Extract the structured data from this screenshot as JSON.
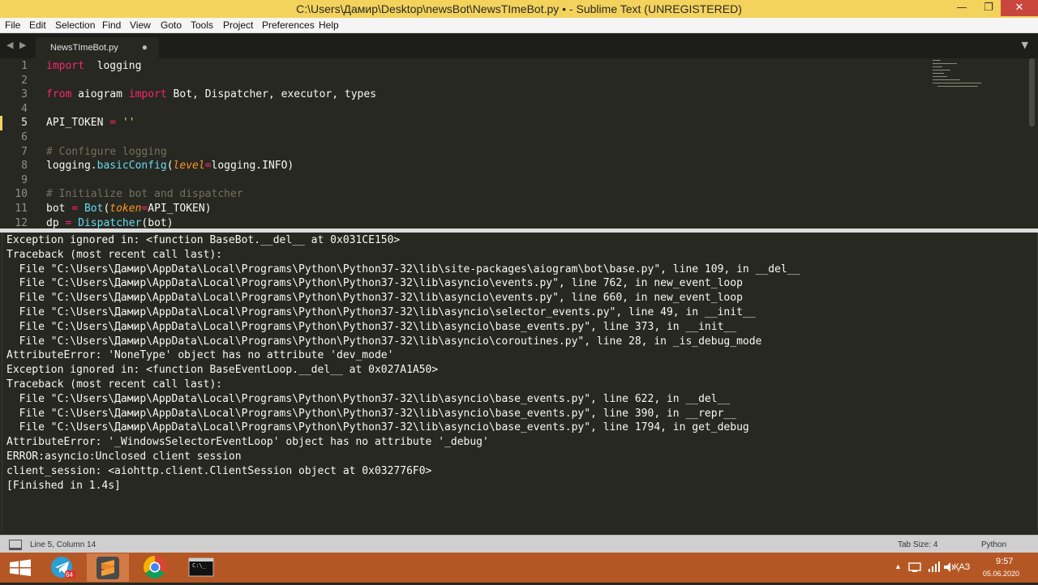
{
  "window": {
    "title": "C:\\Users\\Дамир\\Desktop\\newsBot\\NewsTImeBot.py • - Sublime Text (UNREGISTERED)",
    "minimize_glyph": "—",
    "maximize_glyph": "❐",
    "close_glyph": "✕"
  },
  "menu": [
    "File",
    "Edit",
    "Selection",
    "Find",
    "View",
    "Goto",
    "Tools",
    "Project",
    "Preferences",
    "Help"
  ],
  "tabbar": {
    "nav_glyph": "◀ ▶",
    "dropdown_glyph": "▼",
    "tab": {
      "label": "NewsTImeBot.py",
      "modified_glyph": "●"
    }
  },
  "editor": {
    "line_numbers": [
      "1",
      "2",
      "3",
      "4",
      "5",
      "6",
      "7",
      "8",
      "9",
      "10",
      "11",
      "12"
    ],
    "lines": [
      {
        "parts": [
          [
            "kw",
            "import"
          ],
          [
            "",
            "  logging"
          ]
        ]
      },
      {
        "parts": []
      },
      {
        "parts": [
          [
            "kw",
            "from"
          ],
          [
            "",
            " aiogram "
          ],
          [
            "kw",
            "import"
          ],
          [
            "",
            " Bot, Dispatcher, executor, types"
          ]
        ]
      },
      {
        "parts": []
      },
      {
        "parts": [
          [
            "",
            "API_TOKEN "
          ],
          [
            "kw",
            "="
          ],
          [
            "",
            " "
          ],
          [
            "st",
            "''"
          ]
        ]
      },
      {
        "parts": []
      },
      {
        "parts": [
          [
            "cm",
            "# Configure logging"
          ]
        ]
      },
      {
        "parts": [
          [
            "",
            "logging."
          ],
          [
            "fn",
            "basicConfig"
          ],
          [
            "",
            "("
          ],
          [
            "pa",
            "level"
          ],
          [
            "kw",
            "="
          ],
          [
            "",
            "logging.INFO)"
          ]
        ]
      },
      {
        "parts": []
      },
      {
        "parts": [
          [
            "cm",
            "# Initialize bot and dispatcher"
          ]
        ]
      },
      {
        "parts": [
          [
            "",
            "bot "
          ],
          [
            "kw",
            "="
          ],
          [
            "",
            " "
          ],
          [
            "fn",
            "Bot"
          ],
          [
            "",
            "("
          ],
          [
            "pa",
            "token"
          ],
          [
            "kw",
            "="
          ],
          [
            "",
            "API_TOKEN)"
          ]
        ]
      },
      {
        "parts": [
          [
            "",
            "dp "
          ],
          [
            "kw",
            "="
          ],
          [
            "",
            " "
          ],
          [
            "fn",
            "Dispatcher"
          ],
          [
            "",
            "(bot)"
          ]
        ]
      }
    ]
  },
  "output": [
    "Exception ignored in: <function BaseBot.__del__ at 0x031CE150>",
    "Traceback (most recent call last):",
    "  File \"C:\\Users\\Дамир\\AppData\\Local\\Programs\\Python\\Python37-32\\lib\\site-packages\\aiogram\\bot\\base.py\", line 109, in __del__",
    "  File \"C:\\Users\\Дамир\\AppData\\Local\\Programs\\Python\\Python37-32\\lib\\asyncio\\events.py\", line 762, in new_event_loop",
    "  File \"C:\\Users\\Дамир\\AppData\\Local\\Programs\\Python\\Python37-32\\lib\\asyncio\\events.py\", line 660, in new_event_loop",
    "  File \"C:\\Users\\Дамир\\AppData\\Local\\Programs\\Python\\Python37-32\\lib\\asyncio\\selector_events.py\", line 49, in __init__",
    "  File \"C:\\Users\\Дамир\\AppData\\Local\\Programs\\Python\\Python37-32\\lib\\asyncio\\base_events.py\", line 373, in __init__",
    "  File \"C:\\Users\\Дамир\\AppData\\Local\\Programs\\Python\\Python37-32\\lib\\asyncio\\coroutines.py\", line 28, in _is_debug_mode",
    "AttributeError: 'NoneType' object has no attribute 'dev_mode'",
    "Exception ignored in: <function BaseEventLoop.__del__ at 0x027A1A50>",
    "Traceback (most recent call last):",
    "  File \"C:\\Users\\Дамир\\AppData\\Local\\Programs\\Python\\Python37-32\\lib\\asyncio\\base_events.py\", line 622, in __del__",
    "  File \"C:\\Users\\Дамир\\AppData\\Local\\Programs\\Python\\Python37-32\\lib\\asyncio\\base_events.py\", line 390, in __repr__",
    "  File \"C:\\Users\\Дамир\\AppData\\Local\\Programs\\Python\\Python37-32\\lib\\asyncio\\base_events.py\", line 1794, in get_debug",
    "AttributeError: '_WindowsSelectorEventLoop' object has no attribute '_debug'",
    "ERROR:asyncio:Unclosed client session",
    "client_session: <aiohttp.client.ClientSession object at 0x032776F0>",
    "[Finished in 1.4s]"
  ],
  "statusbar": {
    "position": "Line 5, Column 14",
    "tab_size": "Tab Size: 4",
    "syntax": "Python"
  },
  "taskbar": {
    "telegram_badge": "64",
    "lang": "ҚАЗ",
    "time": "9:57",
    "date": "05.06.2020",
    "tray_arrow": "▲",
    "cmd_label": "C:\\_"
  },
  "colors": {
    "title_accent": "#f3d35c",
    "editor_bg": "#272822",
    "keyword": "#f92672",
    "function": "#66d9ef",
    "comment": "#75715e",
    "param": "#fd971f",
    "taskbar": "#b55724"
  }
}
